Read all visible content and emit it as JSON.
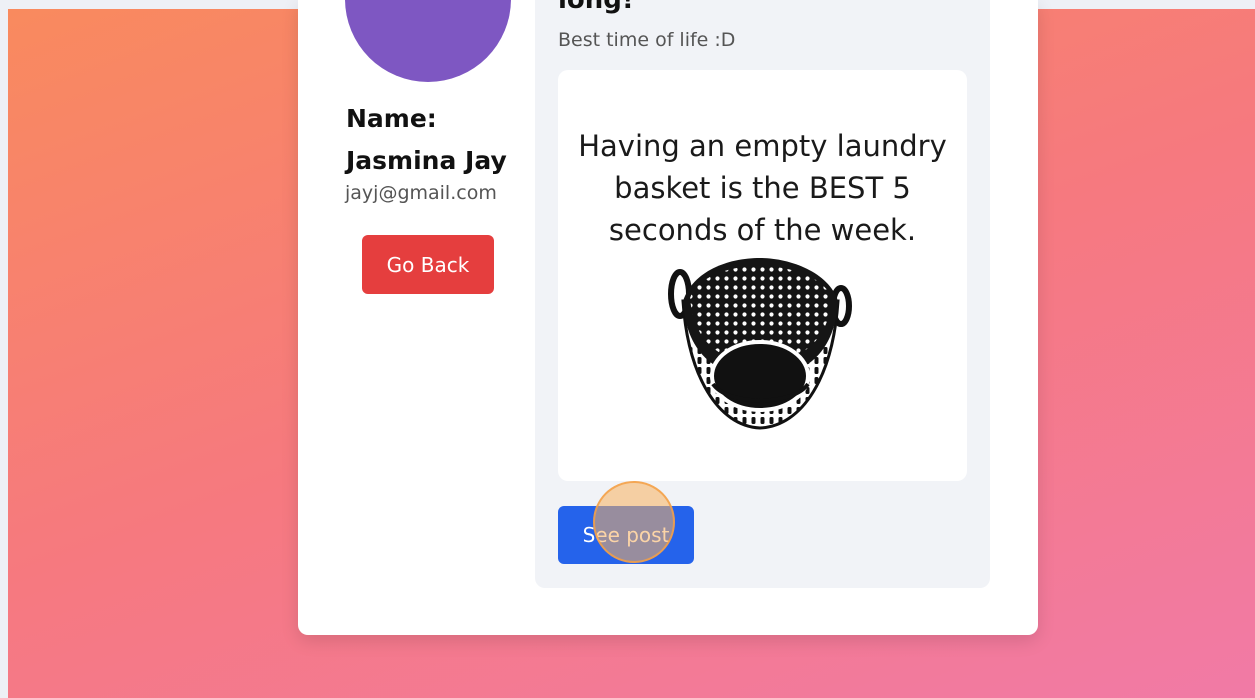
{
  "profile": {
    "name_line1": "Name:",
    "name_line2": "Jasmina Jay",
    "email": "jayj@gmail.com",
    "go_back_label": "Go Back",
    "avatar_color": "#7e57c2"
  },
  "post": {
    "title": "long!",
    "subtitle": "Best time of life :D",
    "image_text_line1": "Having an empty laundry",
    "image_text_line2": "basket is the BEST 5",
    "image_text_line3": "seconds of the week.",
    "see_post_label": "See post"
  },
  "colors": {
    "go_back": "#e53e3e",
    "see_post": "#2563eb",
    "background_start": "#f98a5e",
    "background_end": "#f17aa6"
  }
}
